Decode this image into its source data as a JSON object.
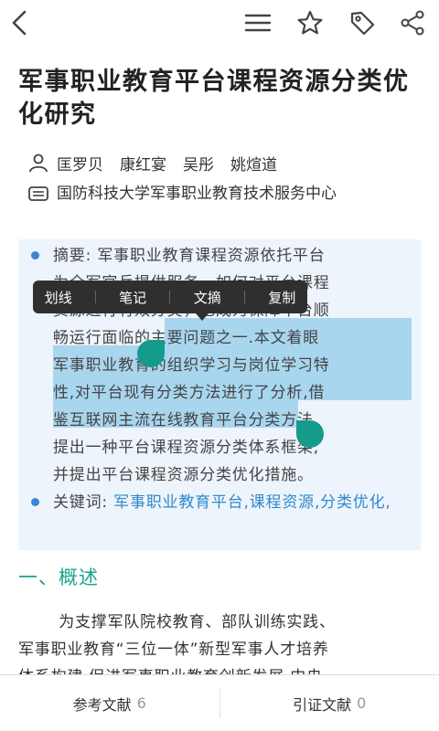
{
  "toolbar": {
    "icons": [
      "back-icon",
      "menu-icon",
      "star-icon",
      "tag-icon",
      "share-icon"
    ]
  },
  "article": {
    "title": "军事职业教育平台课程资源分类优化研究",
    "authors": [
      "匡罗贝",
      "康红宴",
      "吴彤",
      "姚煊道"
    ],
    "organization": "国防科技大学军事职业教育技术服务中心",
    "abstract_label": "摘要:",
    "abstract_lines": [
      "摘要: 军事职业教育课程资源依托平台",
      "为全军官兵提供服务，如何对平台课程",
      "资源进行有效分类，已成为保障平台顺",
      "畅运行面临的主要问题之一.本文着眼",
      "军事职业教育的组织学习与岗位学习特",
      "性,对平台现有分类方法进行了分析,借",
      "鉴互联网主流在线教育平台分类方法,",
      "提出一种平台课程资源分类体系框架,",
      "并提出平台课程资源分类优化措施。"
    ],
    "keywords_label": "关键词:",
    "keywords_text": "军事职业教育平台,课程资源,分类优化,",
    "section_title": "一、概述",
    "body_lines": [
      "为支撑军队院校教育、部队训练实践、",
      "军事职业教育“三位一体”新型军事人才培养",
      "体系构建,促进军事职业教育创新发展,中央"
    ]
  },
  "selection_menu": {
    "items": [
      "划线",
      "笔记",
      "文摘",
      "复制"
    ]
  },
  "bottom_bar": {
    "references_label": "参考文献",
    "references_count": "6",
    "citations_label": "引证文献",
    "citations_count": "0"
  },
  "colors": {
    "accent": "#1aa38f",
    "link": "#2e89cc",
    "highlight": "#a9d6ef",
    "abstract_bg": "#eef4fb",
    "popup_bg": "#2f2f2f"
  }
}
